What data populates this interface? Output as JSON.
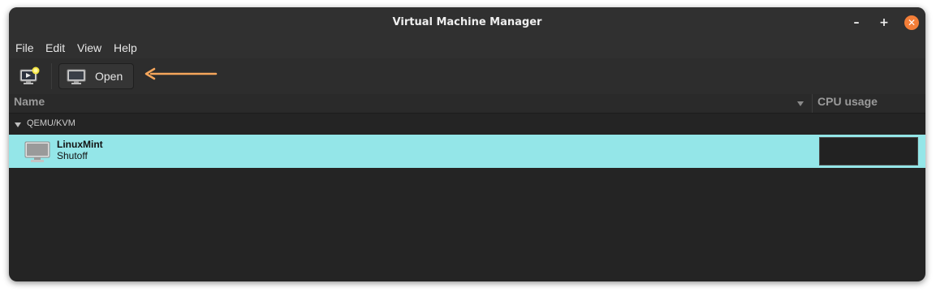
{
  "window": {
    "title": "Virtual Machine Manager",
    "controls": {
      "minimize": "–",
      "maximize": "+",
      "close": "✕"
    }
  },
  "menubar": {
    "items": [
      "File",
      "Edit",
      "View",
      "Help"
    ]
  },
  "toolbar": {
    "new_vm_icon": "new-vm-monitor-icon",
    "open_label": "Open",
    "open_icon": "monitor-icon",
    "annotation": "orange-arrow-pointing-to-open"
  },
  "columns": {
    "name": "Name",
    "cpu": "CPU usage"
  },
  "connection": {
    "label": "QEMU/KVM",
    "expanded": true
  },
  "vms": [
    {
      "name": "LinuxMint",
      "status": "Shutoff",
      "selected": true,
      "icon": "monitor-icon"
    }
  ],
  "colors": {
    "accent_close": "#f37e38",
    "selection": "#94e6e8",
    "annotation_arrow": "#f5a65b",
    "window_bg": "#242424"
  }
}
